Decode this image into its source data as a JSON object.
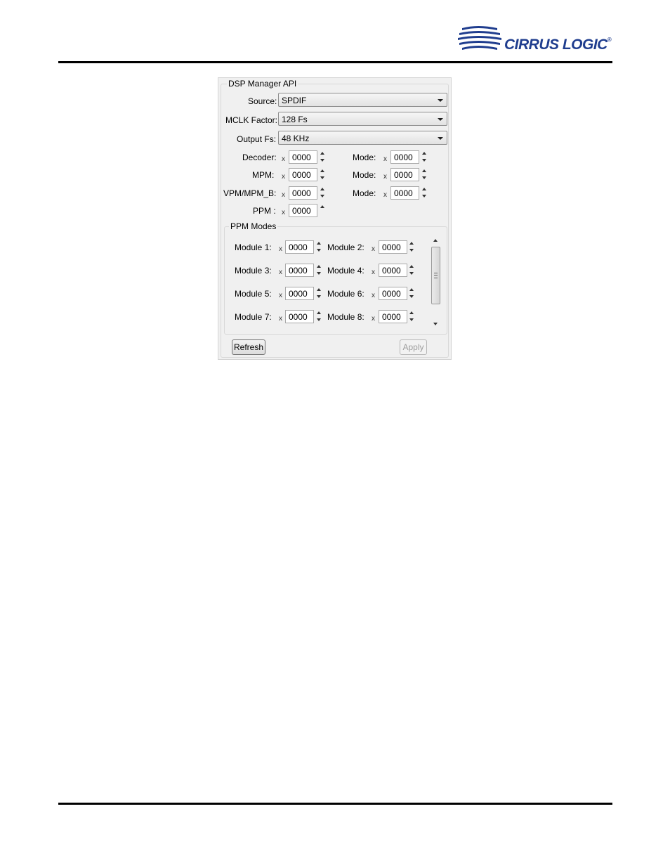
{
  "brand": {
    "name": "CIRRUS LOGIC",
    "registered": "®",
    "color": "#1f3d8e"
  },
  "panel": {
    "title": "DSP Manager API",
    "combos": [
      {
        "label": "Source:",
        "value": "SPDIF"
      },
      {
        "label": "MCLK Factor:",
        "value": "128 Fs"
      },
      {
        "label": "Output Fs:",
        "value": "48 KHz"
      }
    ],
    "hex_prefix": "x",
    "rows": [
      {
        "label": "Decoder:",
        "value": "0000",
        "mode_label": "Mode:",
        "mode_value": "0000"
      },
      {
        "label": "MPM:",
        "value": "0000",
        "mode_label": "Mode:",
        "mode_value": "0000"
      },
      {
        "label": "VPM/MPM_B:",
        "value": "0000",
        "mode_label": "Mode:",
        "mode_value": "0000"
      },
      {
        "label": "PPM :",
        "value": "0000"
      }
    ],
    "ppm_modes": {
      "title": "PPM Modes",
      "modules": [
        {
          "label": "Module 1:",
          "value": "0000"
        },
        {
          "label": "Module 2:",
          "value": "0000"
        },
        {
          "label": "Module 3:",
          "value": "0000"
        },
        {
          "label": "Module 4:",
          "value": "0000"
        },
        {
          "label": "Module 5:",
          "value": "0000"
        },
        {
          "label": "Module 6:",
          "value": "0000"
        },
        {
          "label": "Module 7:",
          "value": "0000"
        },
        {
          "label": "Module 8:",
          "value": "0000"
        }
      ]
    },
    "buttons": {
      "refresh": "Refresh",
      "apply": "Apply"
    }
  }
}
